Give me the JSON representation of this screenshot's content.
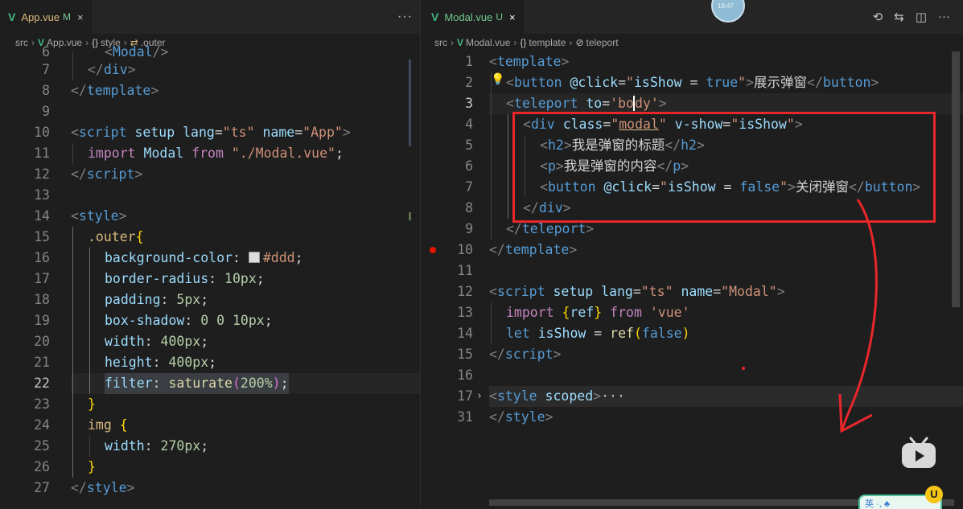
{
  "left": {
    "tab": {
      "filename": "App.vue",
      "status": "M",
      "close": "×"
    },
    "more": "···",
    "breadcrumb": {
      "src": "src",
      "file": "App.vue",
      "section_brace": "{}",
      "section": "style",
      "selector_icon": "⇄",
      "selector": ".outer"
    },
    "partial_line_text": "<Modal/>"
  },
  "right": {
    "tab": {
      "filename": "Modal.vue",
      "status": "U",
      "close": "×"
    },
    "breadcrumb": {
      "src": "src",
      "file": "Modal.vue",
      "section_brace": "{}",
      "section": "template",
      "leaf": "teleport"
    },
    "folded_placeholder": "···",
    "clock": "19:47"
  },
  "colors": {
    "annotation": "#e8272b",
    "vue": "#42b883",
    "bg": "#1e1e1e"
  },
  "icons": [
    "vue-file-icon",
    "close-icon",
    "more-actions-icon",
    "timeline-icon",
    "compare-icon",
    "split-editor-icon",
    "lightbulb-icon",
    "breakpoint-icon",
    "fold-chevron-icon",
    "bilibili-tv-icon"
  ],
  "overlay": {
    "badge": "U",
    "ime": "英 ·, ♣"
  }
}
